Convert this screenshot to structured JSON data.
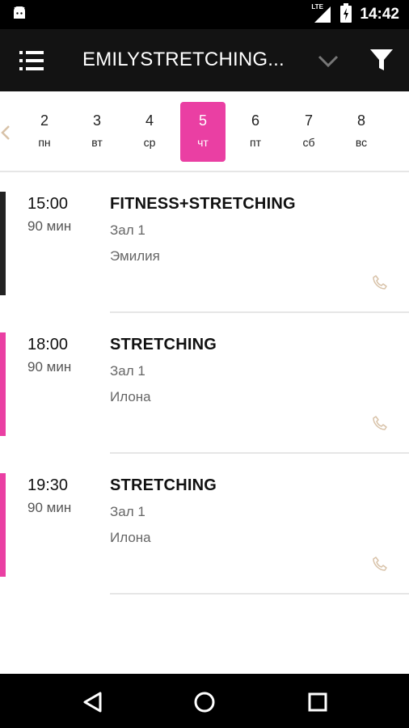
{
  "status_bar": {
    "network": "LTE",
    "time": "14:42"
  },
  "toolbar": {
    "title": "EMILYSTRETCHING..."
  },
  "day_strip": {
    "days": [
      {
        "num": "2",
        "weekday": "пн"
      },
      {
        "num": "3",
        "weekday": "вт"
      },
      {
        "num": "4",
        "weekday": "ср"
      },
      {
        "num": "5",
        "weekday": "чт"
      },
      {
        "num": "6",
        "weekday": "пт"
      },
      {
        "num": "7",
        "weekday": "сб"
      },
      {
        "num": "8",
        "weekday": "вс"
      }
    ],
    "selected_index": 3
  },
  "sessions": [
    {
      "time": "15:00",
      "duration": "90 мин",
      "name": "FITNESS+STRETCHING",
      "hall": "Зал 1",
      "trainer": "Эмилия",
      "color": "#222222"
    },
    {
      "time": "18:00",
      "duration": "90 мин",
      "name": "STRETCHING",
      "hall": "Зал 1",
      "trainer": "Илона",
      "color": "#ea3fa3"
    },
    {
      "time": "19:30",
      "duration": "90 мин",
      "name": "STRETCHING",
      "hall": "Зал 1",
      "trainer": "Илона",
      "color": "#ea3fa3"
    }
  ],
  "colors": {
    "accent": "#ea3fa3",
    "toolbar": "#131313",
    "phone_icon": "#d8c2a8"
  },
  "icons": [
    "android-icon",
    "signal-icon",
    "battery-icon",
    "menu-icon",
    "chevron-down-icon",
    "filter-icon",
    "chevron-left-icon",
    "phone-icon",
    "back-icon",
    "home-icon",
    "recents-icon"
  ]
}
